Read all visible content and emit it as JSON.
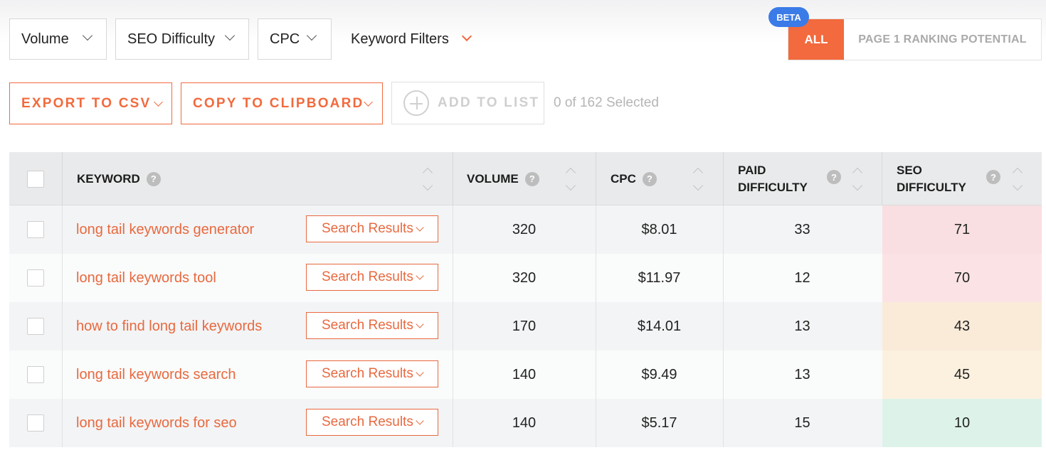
{
  "filters": {
    "volume": "Volume",
    "seo_difficulty": "SEO Difficulty",
    "cpc": "CPC",
    "keyword_filters": "Keyword Filters"
  },
  "segment": {
    "beta_badge": "BETA",
    "all": "ALL",
    "page1": "PAGE 1 RANKING POTENTIAL"
  },
  "actions": {
    "export_csv": "EXPORT TO CSV",
    "copy_clipboard": "COPY TO CLIPBOARD",
    "add_to_list": "ADD TO LIST",
    "selected_count": "0 of 162 Selected"
  },
  "table": {
    "headers": {
      "keyword": "KEYWORD",
      "volume": "VOLUME",
      "cpc": "CPC",
      "paid_difficulty_line1": "PAID",
      "paid_difficulty_line2": "DIFFICULTY",
      "seo_difficulty_line1": "SEO",
      "seo_difficulty_line2": "DIFFICULTY",
      "help": "?"
    },
    "search_results_label": "Search Results",
    "rows": [
      {
        "keyword": "long tail keywords generator",
        "volume": "320",
        "cpc": "$8.01",
        "paid": "33",
        "seo": "71",
        "seo_color": "#f9dfe1"
      },
      {
        "keyword": "long tail keywords tool",
        "volume": "320",
        "cpc": "$11.97",
        "paid": "12",
        "seo": "70",
        "seo_color": "#fbe3e5"
      },
      {
        "keyword": "how to find long tail keywords",
        "volume": "170",
        "cpc": "$14.01",
        "paid": "13",
        "seo": "43",
        "seo_color": "#faebd9"
      },
      {
        "keyword": "long tail keywords search",
        "volume": "140",
        "cpc": "$9.49",
        "paid": "13",
        "seo": "45",
        "seo_color": "#fcf0df"
      },
      {
        "keyword": "long tail keywords for seo",
        "volume": "140",
        "cpc": "$5.17",
        "paid": "15",
        "seo": "10",
        "seo_color": "#ddf3ea"
      }
    ]
  },
  "colors": {
    "accent": "#f26a3d",
    "beta": "#3b7be8"
  }
}
